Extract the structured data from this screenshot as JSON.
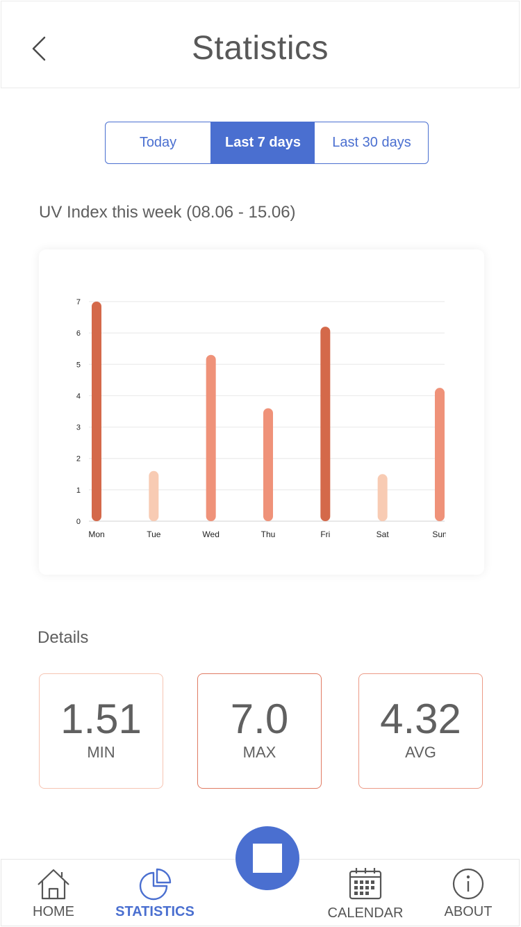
{
  "header": {
    "title": "Statistics",
    "back_icon": "chevron-left-icon"
  },
  "range_tabs": [
    {
      "label": "Today",
      "selected": false
    },
    {
      "label": "Last 7 days",
      "selected": true
    },
    {
      "label": "Last 30 days",
      "selected": false
    }
  ],
  "chart_section": {
    "title": "UV Index this week (08.06 - 15.06)"
  },
  "chart_data": {
    "type": "bar",
    "categories": [
      "Mon",
      "Tue",
      "Wed",
      "Thu",
      "Fri",
      "Sat",
      "Sun"
    ],
    "values": [
      7.0,
      1.6,
      5.3,
      3.6,
      6.2,
      1.5,
      4.25
    ],
    "yticks": [
      0,
      1,
      2,
      3,
      4,
      5,
      6,
      7
    ],
    "ylim": [
      0,
      7
    ],
    "grid": true,
    "colors": [
      "#d4694a",
      "#f8cbb3",
      "#ef9279",
      "#ef9279",
      "#d4694a",
      "#f8cbb3",
      "#ef9279"
    ]
  },
  "details": {
    "title": "Details",
    "stats": [
      {
        "value": "1.51",
        "label": "MIN",
        "border_color": "#f6c4b2"
      },
      {
        "value": "7.0",
        "label": "MAX",
        "border_color": "#e07a62"
      },
      {
        "value": "4.32",
        "label": "AVG",
        "border_color": "#ec9a86"
      }
    ]
  },
  "tabbar": {
    "items": [
      {
        "label": "HOME",
        "icon": "home-icon",
        "active": false
      },
      {
        "label": "STATISTICS",
        "icon": "pie-chart-icon",
        "active": true
      },
      {
        "label": "CALENDAR",
        "icon": "calendar-icon",
        "active": false
      },
      {
        "label": "ABOUT",
        "icon": "info-icon",
        "active": false
      }
    ],
    "fab_icon": "stop-icon"
  },
  "colors": {
    "accent": "#4a6fd0"
  }
}
